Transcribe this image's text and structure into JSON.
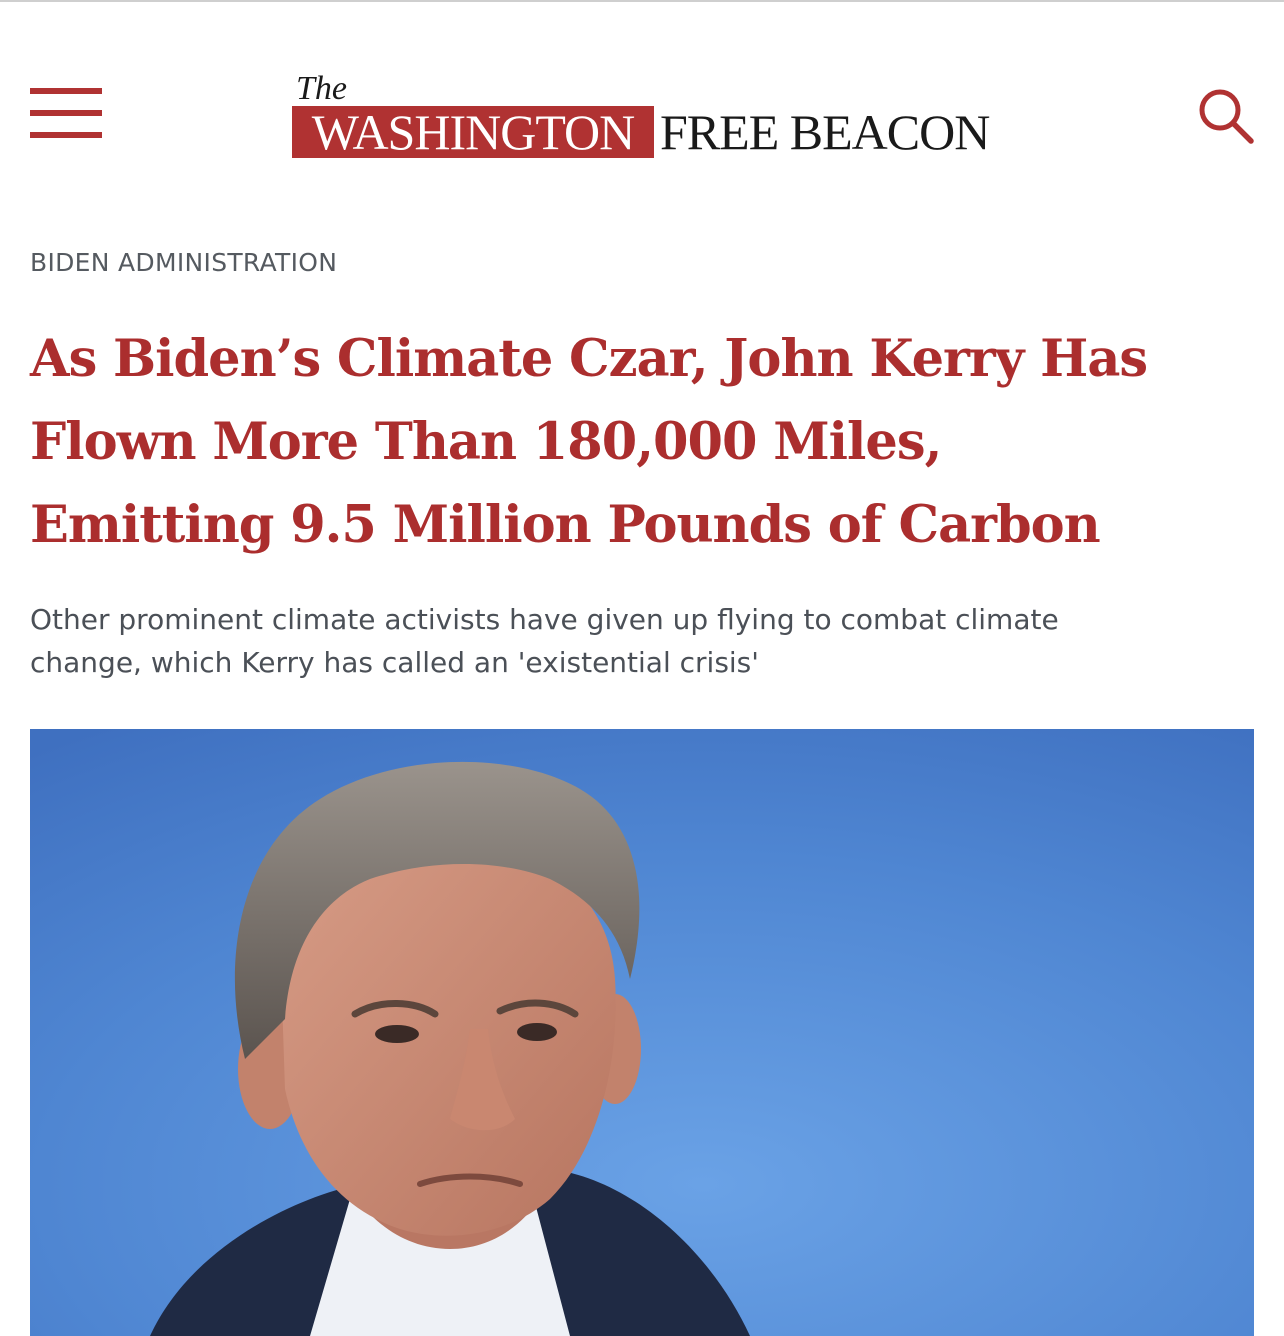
{
  "header": {
    "logo": {
      "the": "The",
      "washington": "WASHINGTON",
      "free_beacon": "FREE BEACON"
    },
    "menu_icon": "hamburger-menu-icon",
    "search_icon": "search-icon"
  },
  "article": {
    "category": "BIDEN ADMINISTRATION",
    "headline_lines": [
      "As Biden’s Climate Czar, John Kerry Has",
      "Flown More Than 180,000 Miles,",
      "Emitting 9.5 Million Pounds of Carbon"
    ],
    "subhead_lines": [
      "Other prominent climate activists have given up flying to combat climate",
      "change, which Kerry has called an 'existential crisis'"
    ]
  },
  "colors": {
    "brand_red": "#b03232",
    "headline_red": "#ab2e2e",
    "text_gray": "#4b5057",
    "photo_background_blue": "#4f86d2"
  }
}
